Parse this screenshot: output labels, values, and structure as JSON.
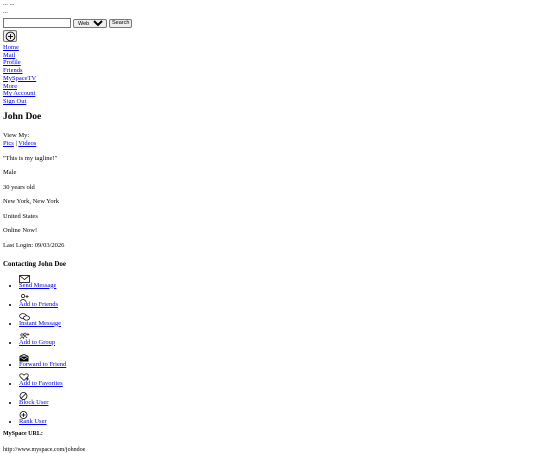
{
  "top": {
    "line1": "... ...",
    "line2": "..."
  },
  "search": {
    "input_value": "",
    "scope_selected": "Web",
    "button_label": "Search"
  },
  "nav": {
    "items": [
      {
        "label": "Home"
      },
      {
        "label": "Mail"
      },
      {
        "label": "Profile"
      },
      {
        "label": "Friends"
      },
      {
        "label": "MySpaceTV"
      },
      {
        "label": "More"
      },
      {
        "label": "My Account"
      },
      {
        "label": "Sign Out"
      }
    ]
  },
  "profile": {
    "name": "John Doe",
    "view_my_label": "View My:",
    "pics_label": "Pics",
    "separator": "|",
    "videos_label": "Videos",
    "tagline": "\"This is my tagline!\"",
    "gender": "Male",
    "age": "30 years old",
    "city": "New York, New York",
    "country": "United States",
    "online": "Online Now!",
    "last_login": "Last Login: 09/03/2026"
  },
  "contacting": {
    "heading": "Contacting John Doe",
    "group1": [
      {
        "label": "Send Message",
        "icon": "envelope-icon"
      },
      {
        "label": "Add to Friends",
        "icon": "add-person-icon"
      },
      {
        "label": "Instant Message",
        "icon": "chat-bubbles-icon"
      },
      {
        "label": "Add to Group",
        "icon": "group-icon"
      }
    ],
    "group2": [
      {
        "label": "Forward to Friend",
        "icon": "forward-mail-icon"
      },
      {
        "label": "Add to Favorites",
        "icon": "heart-plus-icon"
      },
      {
        "label": "Block User",
        "icon": "block-icon"
      },
      {
        "label": "Rank User",
        "icon": "plus-circle-icon"
      }
    ]
  },
  "url": {
    "heading": "MySpace URL:",
    "value": "http://www.myspace.com/johndoe"
  }
}
